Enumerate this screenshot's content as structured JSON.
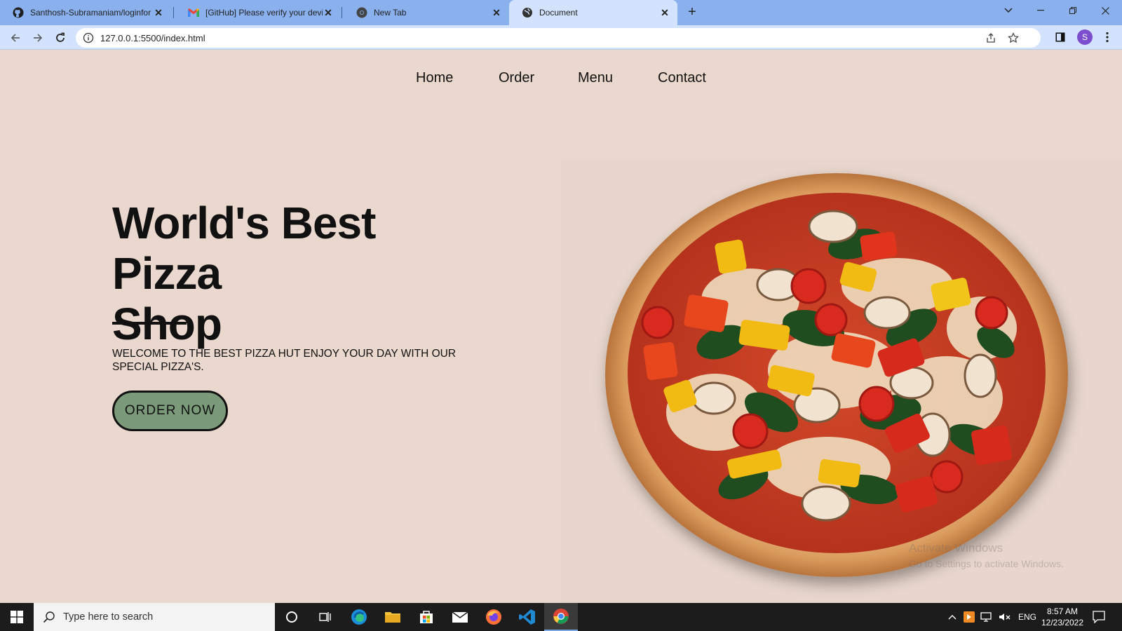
{
  "browser": {
    "tabs": [
      {
        "label": "Santhosh-Subramaniam/loginfor",
        "icon": "github-icon"
      },
      {
        "label": "[GitHub] Please verify your devic",
        "icon": "gmail-icon"
      },
      {
        "label": "New Tab",
        "icon": "chrome-icon"
      },
      {
        "label": "Document",
        "icon": "globe-icon",
        "active": true
      }
    ],
    "url": "127.0.0.1:5500/index.html",
    "avatar_letter": "S"
  },
  "page": {
    "nav": [
      "Home",
      "Order",
      "Menu",
      "Contact"
    ],
    "hero": {
      "title_line1": "World's Best Pizza",
      "title_line2": "Shop",
      "subtitle": "WELCOME TO THE BEST PIZZA HUT ENJOY YOUR DAY WITH OUR SPECIAL PIZZA'S.",
      "cta": "ORDER NOW"
    },
    "watermark": {
      "line1": "Activate Windows",
      "line2": "Go to Settings to activate Windows."
    }
  },
  "taskbar": {
    "search_placeholder": "Type here to search",
    "language": "ENG",
    "time": "8:57 AM",
    "date": "12/23/2022"
  },
  "colors": {
    "page_bg": "#ead7cd",
    "button_bg": "#7a9a7a",
    "tabbar_bg": "#8ab1ee",
    "toolbar_bg": "#d3e3fd"
  }
}
